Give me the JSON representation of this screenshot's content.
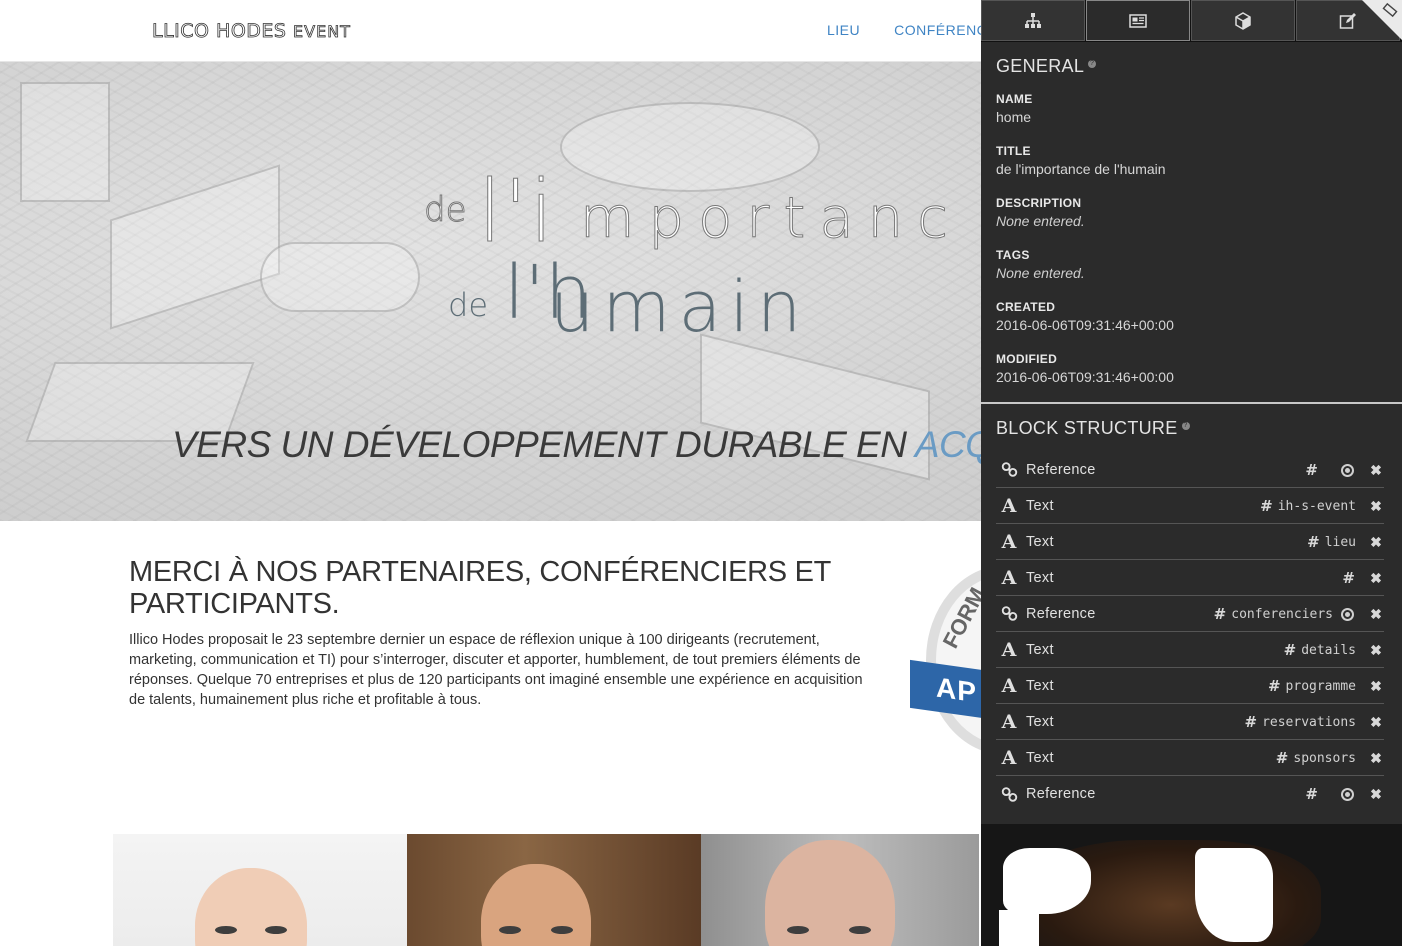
{
  "site": {
    "logo": {
      "main": "LLICO HODES",
      "suffix": "EVENT"
    },
    "nav": [
      "LIEU",
      "CONFÉRENCIE"
    ],
    "hero": {
      "line1_de": "de",
      "line1_l": "l'i",
      "line1_rest": "mportanc",
      "line2_de": "de",
      "line2_l": "l'h",
      "line2_rest": "umain",
      "tagline_main": "VERS UN DÉVELOPPEMENT DURABLE EN ",
      "tagline_accent": "ACQUISI"
    },
    "content": {
      "heading": "MERCI À NOS PARTENAIRES, CONFÉRENCIERS ET PARTICIPANTS.",
      "body": "Illico Hodes proposait le 23 septembre dernier un espace de réflexion unique à 100 dirigeants (recrutement, marketing, communication et TI) pour s’interroger, discuter et apporter, humblement, de tout premiers éléments de réponses. Quelque 70 entreprises et plus de 120 participants ont imaginé ensemble une expérience en acquisition de talents, humainement plus riche et profitable à tous."
    },
    "badge": {
      "arc_text": "FORM",
      "ribbon_text": "AP"
    }
  },
  "inspector": {
    "tabs": [
      {
        "icon": "sitemap-icon"
      },
      {
        "icon": "newspaper-icon",
        "active": true
      },
      {
        "icon": "cube-icon"
      },
      {
        "icon": "edit-icon"
      }
    ],
    "general": {
      "title": "GENERAL",
      "name_label": "NAME",
      "name_value": "home",
      "title_label": "TITLE",
      "title_value": "de l'importance de l'humain",
      "description_label": "DESCRIPTION",
      "description_value": "None entered.",
      "tags_label": "TAGS",
      "tags_value": "None entered.",
      "created_label": "CREATED",
      "created_value": "2016-06-06T09:31:46+00:00",
      "modified_label": "MODIFIED",
      "modified_value": "2016-06-06T09:31:46+00:00"
    },
    "block_structure": {
      "title": "BLOCK STRUCTURE",
      "blocks": [
        {
          "type": "Reference",
          "icon": "link-icon",
          "anchor": "",
          "target": true
        },
        {
          "type": "Text",
          "icon": "text-icon",
          "anchor": "ih-s-event",
          "target": false
        },
        {
          "type": "Text",
          "icon": "text-icon",
          "anchor": "lieu",
          "target": false
        },
        {
          "type": "Text",
          "icon": "text-icon",
          "anchor": "",
          "target": false
        },
        {
          "type": "Reference",
          "icon": "link-icon",
          "anchor": "conferenciers",
          "target": true
        },
        {
          "type": "Text",
          "icon": "text-icon",
          "anchor": "details",
          "target": false
        },
        {
          "type": "Text",
          "icon": "text-icon",
          "anchor": "programme",
          "target": false
        },
        {
          "type": "Text",
          "icon": "text-icon",
          "anchor": "reservations",
          "target": false
        },
        {
          "type": "Text",
          "icon": "text-icon",
          "anchor": "sponsors",
          "target": false
        },
        {
          "type": "Reference",
          "icon": "link-icon",
          "anchor": "",
          "target": true
        }
      ]
    }
  },
  "colors": {
    "panel_bg": "#2b2b2b",
    "nav_link": "#3f84c4",
    "hero_accent": "#6a9bc4",
    "hero_title": "#5d6d76"
  }
}
